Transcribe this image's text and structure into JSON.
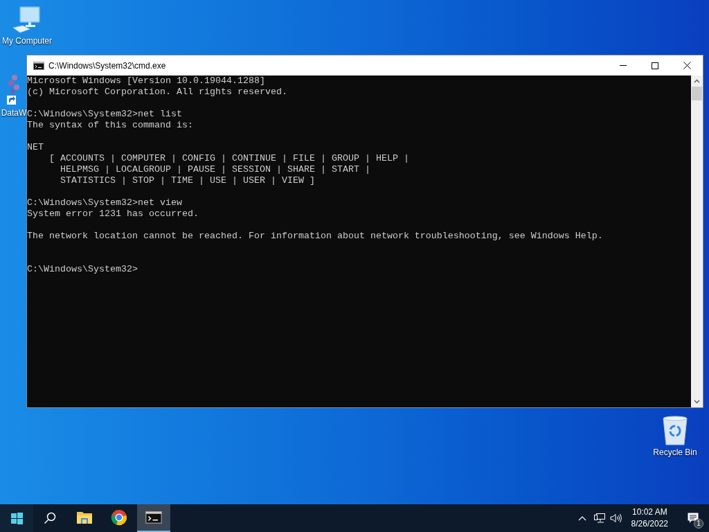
{
  "desktop_icons": [
    {
      "kind": "computer",
      "label": "My Computer"
    },
    {
      "kind": "shortcut",
      "label": "DataW"
    },
    {
      "kind": "recycle_bin",
      "label": "Recycle Bin"
    }
  ],
  "window": {
    "title": "C:\\Windows\\System32\\cmd.exe",
    "console": [
      "Microsoft Windows [Version 10.0.19044.1288]\n(c) Microsoft Corporation. All rights reserved.\n\nC:\\Windows\\System32>net list\nThe syntax of this command is:\n\nNET\n    [ ACCOUNTS | COMPUTER | CONFIG | CONTINUE | FILE | GROUP | HELP |\n      HELPMSG | LOCALGROUP | PAUSE | SESSION | SHARE | START |\n      STATISTICS | STOP | TIME | USE | USER | VIEW ]\n\nC:\\Windows\\System32>net view\nSystem error 1231 has occurred.\n\nThe network location cannot be reached. For information about network troubleshooting, see Windows Help.\n\n\nC:\\Windows\\System32>"
    ]
  },
  "taskbar": {
    "apps": [
      {
        "kind": "explorer",
        "selected": false
      },
      {
        "kind": "browser",
        "selected": false
      },
      {
        "kind": "terminal",
        "selected": true
      }
    ],
    "clock": {
      "time": "10:02 AM",
      "date": "8/26/2022"
    },
    "notification_count": "1"
  }
}
